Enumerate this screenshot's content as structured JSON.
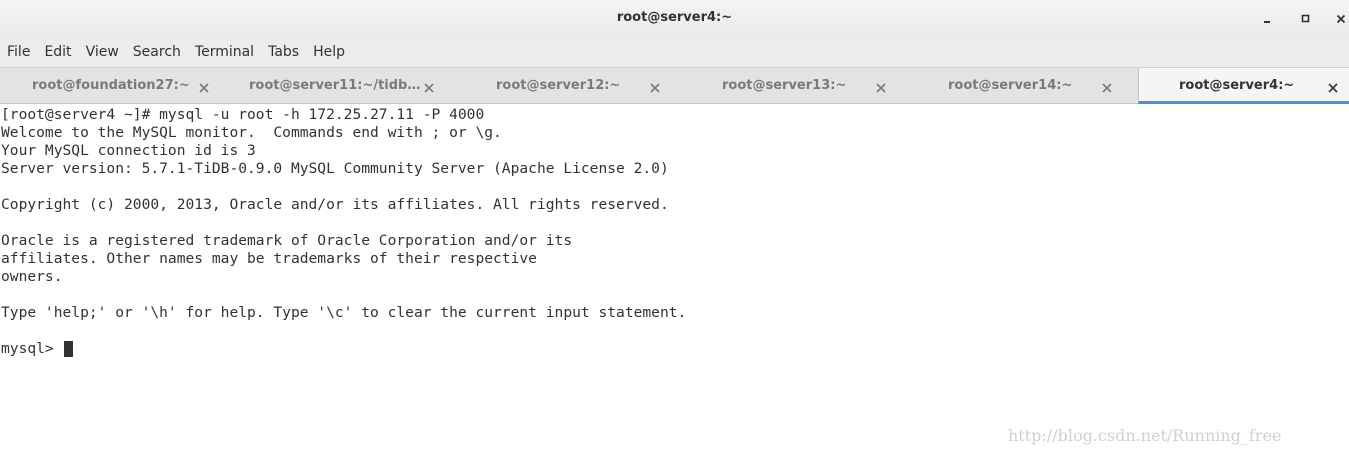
{
  "window": {
    "title": "root@server4:~"
  },
  "menubar": {
    "items": [
      "File",
      "Edit",
      "View",
      "Search",
      "Terminal",
      "Tabs",
      "Help"
    ]
  },
  "tabs": [
    {
      "label": "root@foundation27:~",
      "active": false
    },
    {
      "label": "root@server11:~/tidb…",
      "active": false
    },
    {
      "label": "root@server12:~",
      "active": false
    },
    {
      "label": "root@server13:~",
      "active": false
    },
    {
      "label": "root@server14:~",
      "active": false
    },
    {
      "label": "root@server4:~",
      "active": true
    }
  ],
  "terminal": {
    "lines": [
      "[root@server4 ~]# mysql -u root -h 172.25.27.11 -P 4000",
      "Welcome to the MySQL monitor.  Commands end with ; or \\g.",
      "Your MySQL connection id is 3",
      "Server version: 5.7.1-TiDB-0.9.0 MySQL Community Server (Apache License 2.0)",
      "",
      "Copyright (c) 2000, 2013, Oracle and/or its affiliates. All rights reserved.",
      "",
      "Oracle is a registered trademark of Oracle Corporation and/or its",
      "affiliates. Other names may be trademarks of their respective",
      "owners.",
      "",
      "Type 'help;' or '\\h' for help. Type '\\c' to clear the current input statement.",
      "",
      "mysql> "
    ]
  },
  "watermark": "http://blog.csdn.net/Running_free",
  "colors": {
    "accent": "#4a90d9",
    "text": "#2e3436",
    "inactive_tab_text": "#7a7a7a"
  }
}
